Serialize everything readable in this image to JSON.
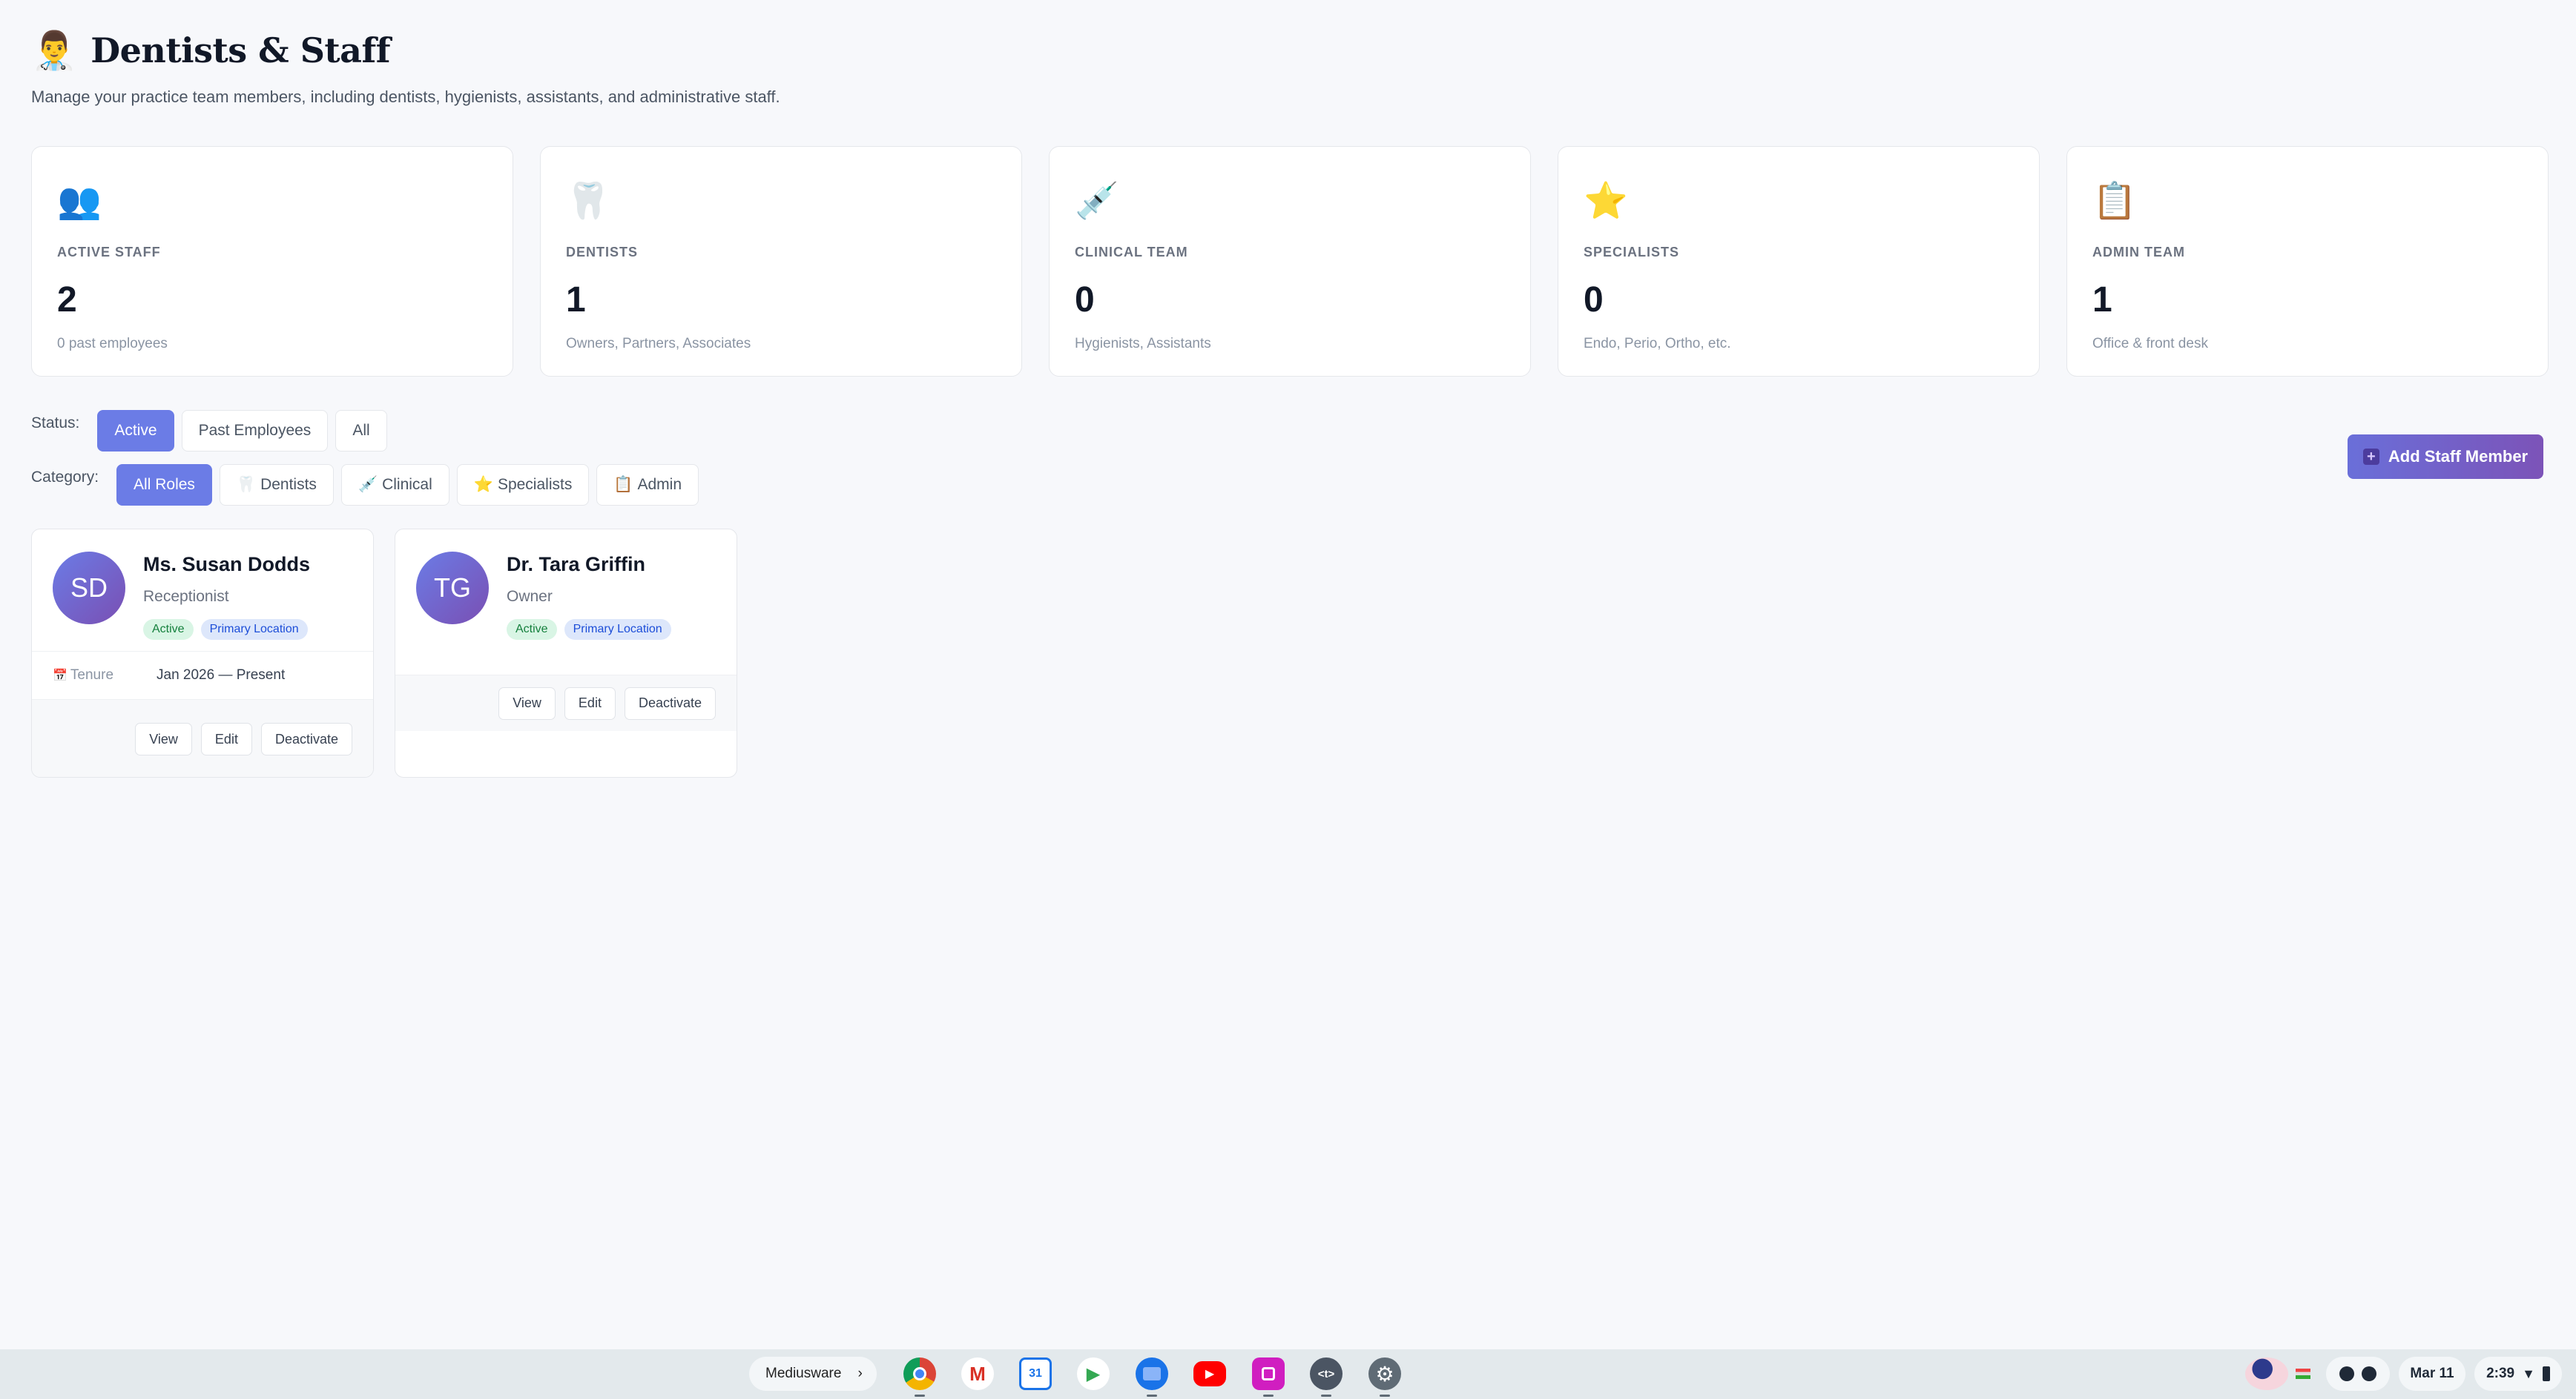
{
  "header": {
    "emoji": "👨‍⚕️",
    "title": "Dentists & Staff",
    "subtitle": "Manage your practice team members, including dentists, hygienists, assistants, and administrative staff."
  },
  "stats": [
    {
      "icon": "👥",
      "icon_name": "people-icon",
      "label": "ACTIVE STAFF",
      "value": "2",
      "sub": "0 past employees"
    },
    {
      "icon": "🦷",
      "icon_name": "tooth-icon",
      "label": "DENTISTS",
      "value": "1",
      "sub": "Owners, Partners, Associates"
    },
    {
      "icon": "💉",
      "icon_name": "syringe-icon",
      "label": "CLINICAL TEAM",
      "value": "0",
      "sub": "Hygienists, Assistants"
    },
    {
      "icon": "⭐",
      "icon_name": "star-icon",
      "label": "SPECIALISTS",
      "value": "0",
      "sub": "Endo, Perio, Ortho, etc."
    },
    {
      "icon": "📋",
      "icon_name": "clipboard-icon",
      "label": "ADMIN TEAM",
      "value": "1",
      "sub": "Office & front desk"
    }
  ],
  "filters": {
    "status_label": "Status:",
    "status_options": [
      "Active",
      "Past Employees",
      "All"
    ],
    "status_selected": "Active",
    "category_label": "Category:",
    "category_options": [
      {
        "icon": "",
        "label": "All Roles"
      },
      {
        "icon": "🦷",
        "label": "Dentists"
      },
      {
        "icon": "💉",
        "label": "Clinical"
      },
      {
        "icon": "⭐",
        "label": "Specialists"
      },
      {
        "icon": "📋",
        "label": "Admin"
      }
    ],
    "category_selected": "All Roles"
  },
  "add_button_label": "Add Staff Member",
  "staff": [
    {
      "initials": "SD",
      "name": "Ms. Susan Dodds",
      "role": "Receptionist",
      "badges": [
        "Active",
        "Primary Location"
      ],
      "tenure_icon": "📅",
      "tenure_label": "Tenure",
      "tenure_value": "Jan 2026 — Present",
      "actions": [
        "View",
        "Edit",
        "Deactivate"
      ]
    },
    {
      "initials": "TG",
      "name": "Dr. Tara Griffin",
      "role": "Owner",
      "badges": [
        "Active",
        "Primary Location"
      ],
      "actions": [
        "View",
        "Edit",
        "Deactivate"
      ]
    }
  ],
  "taskbar": {
    "workspace_label": "Mediusware",
    "workspace_chevron": "›",
    "apps": [
      {
        "name": "chrome-icon",
        "glyph": "",
        "color": "#db4437"
      },
      {
        "name": "gmail-icon",
        "glyph": "M",
        "color": "#ffffff"
      },
      {
        "name": "calendar-icon",
        "glyph": "31",
        "color": "#1a73e8"
      },
      {
        "name": "play-store-icon",
        "glyph": "▶",
        "color": "#ffffff"
      },
      {
        "name": "files-icon",
        "glyph": "",
        "color": "#1a73e8"
      },
      {
        "name": "youtube-icon",
        "glyph": "▶",
        "color": "#ff0000"
      },
      {
        "name": "screenshot-app-icon",
        "glyph": "",
        "color": "#d01ec0"
      },
      {
        "name": "code-editor-icon",
        "glyph": "<t>",
        "color": "#4b5563"
      },
      {
        "name": "settings-icon",
        "glyph": "⚙",
        "color": "#5f6b75"
      }
    ],
    "date": "Mar 11",
    "time": "2:39"
  }
}
